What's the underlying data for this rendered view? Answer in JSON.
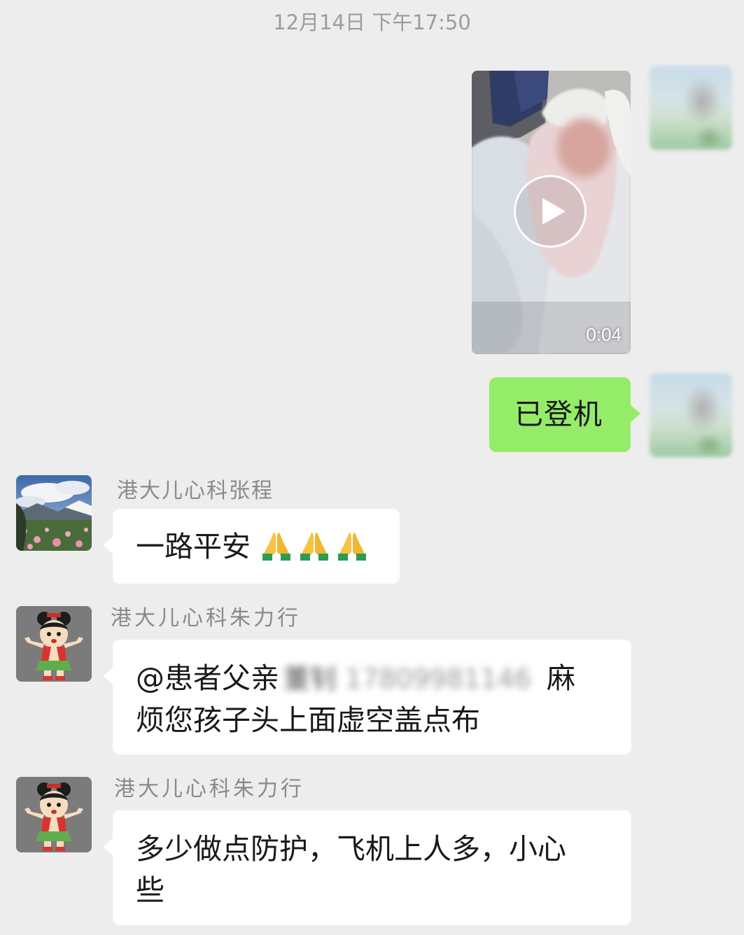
{
  "timestamp": "12月14日 下午17:50",
  "messages": [
    {
      "side": "right",
      "type": "video",
      "duration": "0:04"
    },
    {
      "side": "right",
      "type": "text",
      "text": "已登机"
    },
    {
      "side": "left",
      "type": "text",
      "sender": "港大儿心科张程",
      "text": "一路平安",
      "emoji": [
        "folded-hands",
        "folded-hands",
        "folded-hands"
      ]
    },
    {
      "side": "left",
      "type": "text",
      "sender": "港大儿心科朱力行",
      "mention": "@患者父亲",
      "blurred_name": "董钊",
      "blurred_phone": "17809981146",
      "line1_end": "麻",
      "line2": "烦您孩子头上面虚空盖点布"
    },
    {
      "side": "left",
      "type": "text",
      "sender": "港大儿心科朱力行",
      "line1": "多少做点防护，飞机上人多，小心",
      "line2": "些"
    }
  ],
  "colors": {
    "background": "#ededed",
    "self_bubble": "#95ec69",
    "other_bubble": "#ffffff",
    "timestamp_text": "#9c9c9c",
    "sender_name": "#8a8a8a"
  }
}
